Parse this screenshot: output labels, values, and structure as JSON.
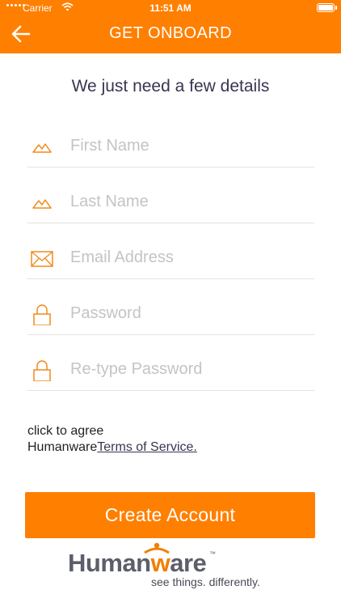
{
  "status_bar": {
    "carrier": "Carrier",
    "time": "11:51 AM"
  },
  "header": {
    "title": "GET ONBOARD",
    "back_icon": "arrow-left-icon"
  },
  "subtitle": "We just need a few details",
  "fields": [
    {
      "name": "first-name",
      "icon": "mountain-icon",
      "placeholder": "First Name",
      "value": ""
    },
    {
      "name": "last-name",
      "icon": "mountain-icon",
      "placeholder": "Last Name",
      "value": ""
    },
    {
      "name": "email",
      "icon": "envelope-icon",
      "placeholder": "Email Address",
      "value": ""
    },
    {
      "name": "password",
      "icon": "lock-icon",
      "placeholder": "Password",
      "value": ""
    },
    {
      "name": "retype-password",
      "icon": "lock-icon",
      "placeholder": "Re-type Password",
      "value": ""
    }
  ],
  "agreement": {
    "line1": "click to agree",
    "prefix": "Humanware",
    "link": "Terms of Service."
  },
  "create_button": "Create Account",
  "brand": {
    "name_start": "Human",
    "name_accent": "w",
    "name_end": "are",
    "tagline": "see things. differently.",
    "accent_color": "#ff7f00"
  }
}
